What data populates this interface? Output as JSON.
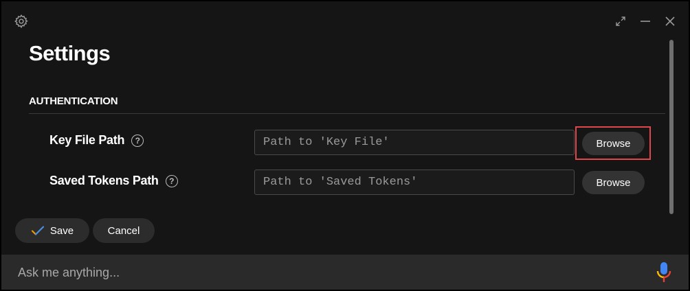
{
  "header": {
    "title": "Settings",
    "icons": [
      "gear-icon",
      "expand-icon",
      "minimize-icon",
      "close-icon"
    ]
  },
  "section": {
    "heading": "AUTHENTICATION"
  },
  "settings": {
    "key_file": {
      "label": "Key File Path",
      "placeholder": "Path to 'Key File'",
      "value": "",
      "button_label": "Browse"
    },
    "saved_tokens": {
      "label": "Saved Tokens Path",
      "placeholder": "Path to 'Saved Tokens'",
      "value": "",
      "button_label": "Browse"
    }
  },
  "actions": {
    "save_label": "Save",
    "cancel_label": "Cancel"
  },
  "assistant": {
    "placeholder": "Ask me anything..."
  },
  "colors": {
    "background": "#151515",
    "highlight": "#e0474c",
    "button": "#333333",
    "mic_blue": "#4285f4",
    "mic_red": "#ea4335",
    "mic_yellow": "#fbbc05",
    "check_orange": "#f29900",
    "check_blue": "#4a90e2"
  }
}
